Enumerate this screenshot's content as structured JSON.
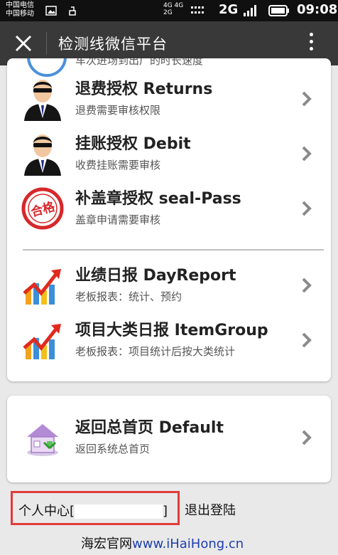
{
  "status_bar": {
    "carrier_1": "中国电信",
    "carrier_2": "中国移动",
    "network_top": "4G 4G",
    "network_bottom": "2G",
    "network_type": "2G",
    "time": "09:08"
  },
  "app_bar": {
    "title": "检测线微信平台"
  },
  "menu": {
    "partial_subtitle": "车次进场到出厂的时长速度",
    "items": [
      {
        "title": "退费授权 Returns",
        "subtitle": "退费需要审核权限",
        "icon": "agent-avatar-icon"
      },
      {
        "title": "挂账授权 Debit",
        "subtitle": "收费挂账需要审核",
        "icon": "agent-avatar-icon"
      },
      {
        "title": "补盖章授权 seal-Pass",
        "subtitle": "盖章申请需要审核",
        "icon": "approved-stamp-icon",
        "stamp_text": "合格"
      },
      {
        "title": "业绩日报 DayReport",
        "subtitle": "老板报表：统计、预约",
        "icon": "growth-chart-icon"
      },
      {
        "title": "项目大类日报 ItemGroup",
        "subtitle": "老板报表：项目统计后按大类统计",
        "icon": "growth-chart-icon"
      }
    ]
  },
  "home": {
    "title": "返回总首页 Default",
    "subtitle": "返回系统总首页",
    "icon": "home-icon"
  },
  "footer": {
    "personal_center": "个人中心[",
    "personal_center_end": "]",
    "logout": "退出登陆",
    "site_label": "海宏官网",
    "site_url": "www.iHaiHong.cn"
  },
  "colors": {
    "app_bar": "#393939",
    "highlight_border": "#e23b3b",
    "link": "#1e3fb0"
  }
}
